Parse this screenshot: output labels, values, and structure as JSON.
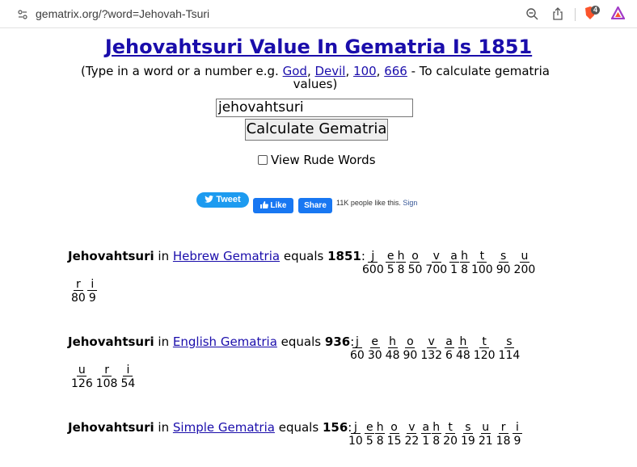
{
  "browser": {
    "url": "gematrix.org/?word=Jehovah-Tsuri",
    "shield_count": "4"
  },
  "page": {
    "title": "Jehovahtsuri Value In Gematria Is 1851",
    "sub_prefix": "(Type in a word or a number e.g. ",
    "examples": [
      "God",
      "Devil",
      "100",
      "666"
    ],
    "sub_suffix": " - To calculate gematria values)",
    "input_value": "jehovahtsuri",
    "calc_button": "Calculate Gematria",
    "rude_label": "View Rude Words"
  },
  "social": {
    "tweet": "Tweet",
    "like": "Like",
    "share": "Share",
    "fb_text": "11K people like this.",
    "fb_link": "Sign"
  },
  "results": [
    {
      "word": "Jehovahtsuri",
      "in": "in",
      "system": "Hebrew Gematria",
      "equals": "equals",
      "total": "1851",
      "row1": [
        [
          "j",
          "600"
        ],
        [
          "e",
          "5"
        ],
        [
          "h",
          "8"
        ],
        [
          "o",
          "50"
        ],
        [
          "v",
          "700"
        ],
        [
          "a",
          "1"
        ],
        [
          "h",
          "8"
        ],
        [
          "t",
          "100"
        ],
        [
          "s",
          "90"
        ],
        [
          "u",
          "200"
        ]
      ],
      "row2": [
        [
          "r",
          "80"
        ],
        [
          "i",
          "9"
        ]
      ]
    },
    {
      "word": "Jehovahtsuri",
      "in": "in",
      "system": "English Gematria",
      "equals": "equals",
      "total": "936",
      "row1": [
        [
          "j",
          "60"
        ],
        [
          "e",
          "30"
        ],
        [
          "h",
          "48"
        ],
        [
          "o",
          "90"
        ],
        [
          "v",
          "132"
        ],
        [
          "a",
          "6"
        ],
        [
          "h",
          "48"
        ],
        [
          "t",
          "120"
        ],
        [
          "s",
          "114"
        ]
      ],
      "row2": [
        [
          "u",
          "126"
        ],
        [
          "r",
          "108"
        ],
        [
          "i",
          "54"
        ]
      ]
    },
    {
      "word": "Jehovahtsuri",
      "in": "in",
      "system": "Simple Gematria",
      "equals": "equals",
      "total": "156",
      "row1": [
        [
          "j",
          "10"
        ],
        [
          "e",
          "5"
        ],
        [
          "h",
          "8"
        ],
        [
          "o",
          "15"
        ],
        [
          "v",
          "22"
        ],
        [
          "a",
          "1"
        ],
        [
          "h",
          "8"
        ],
        [
          "t",
          "20"
        ],
        [
          "s",
          "19"
        ],
        [
          "u",
          "21"
        ],
        [
          "r",
          "18"
        ],
        [
          "i",
          "9"
        ]
      ],
      "row2": []
    }
  ]
}
